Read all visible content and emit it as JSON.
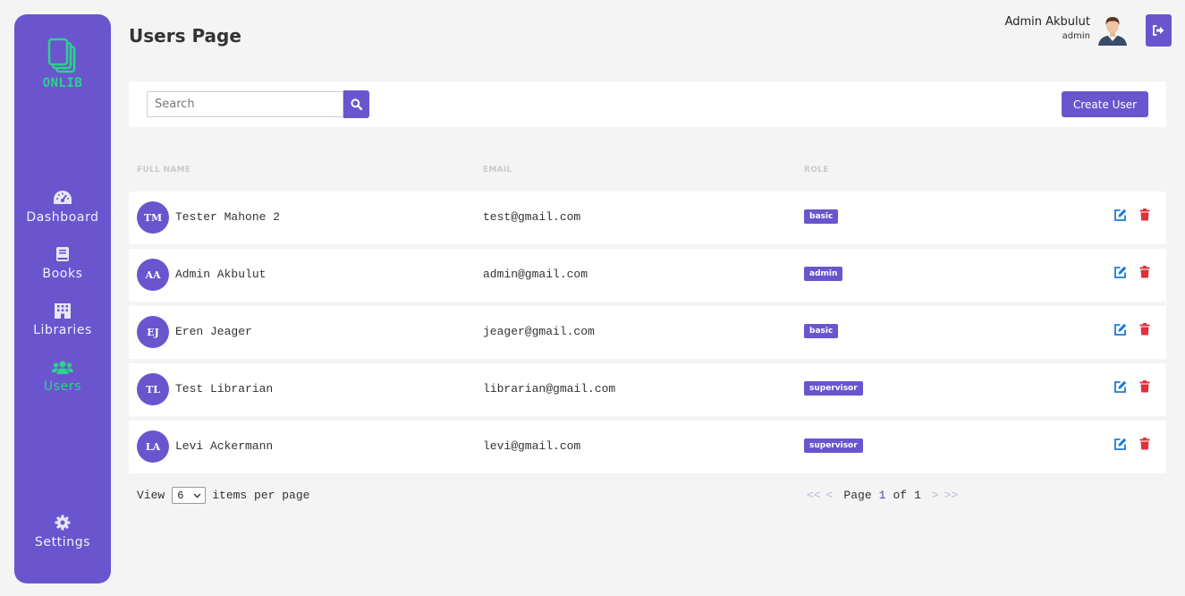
{
  "brand": {
    "name": "ONLIB",
    "accent": "#6a55cf",
    "logo_color": "#2bd38a"
  },
  "sidebar": {
    "items": [
      {
        "label": "Dashboard",
        "icon": "dashboard-gauge-icon",
        "active": false
      },
      {
        "label": "Books",
        "icon": "book-icon",
        "active": false
      },
      {
        "label": "Libraries",
        "icon": "building-icon",
        "active": false
      },
      {
        "label": "Users",
        "icon": "users-icon",
        "active": true
      },
      {
        "label": "Settings",
        "icon": "gear-icon",
        "active": false
      }
    ]
  },
  "header": {
    "title": "Users Page",
    "user_name": "Admin Akbulut",
    "user_role": "admin",
    "logout_icon": "sign-out-icon"
  },
  "toolbar": {
    "search_placeholder": "Search",
    "search_value": "",
    "create_label": "Create User"
  },
  "table": {
    "columns": [
      "FULL NAME",
      "EMAIL",
      "ROLE"
    ],
    "rows": [
      {
        "initials": "TM",
        "name": "Tester Mahone 2",
        "email": "test@gmail.com",
        "role": "basic"
      },
      {
        "initials": "AA",
        "name": "Admin Akbulut",
        "email": "admin@gmail.com",
        "role": "admin"
      },
      {
        "initials": "EJ",
        "name": "Eren Jeager",
        "email": "jeager@gmail.com",
        "role": "basic"
      },
      {
        "initials": "TL",
        "name": "Test Librarian",
        "email": "librarian@gmail.com",
        "role": "supervisor"
      },
      {
        "initials": "LA",
        "name": "Levi Ackermann",
        "email": "levi@gmail.com",
        "role": "supervisor"
      }
    ],
    "edit_color": "#1a7bd8",
    "delete_color": "#e0303a"
  },
  "footer": {
    "view_label": "View",
    "per_page_value": "6",
    "per_page_suffix": "items per page",
    "first": "<<",
    "prev": "<",
    "page_label": "Page",
    "current_page": "1",
    "of_label": "of",
    "total_pages": "1",
    "next": ">",
    "last": ">>"
  }
}
